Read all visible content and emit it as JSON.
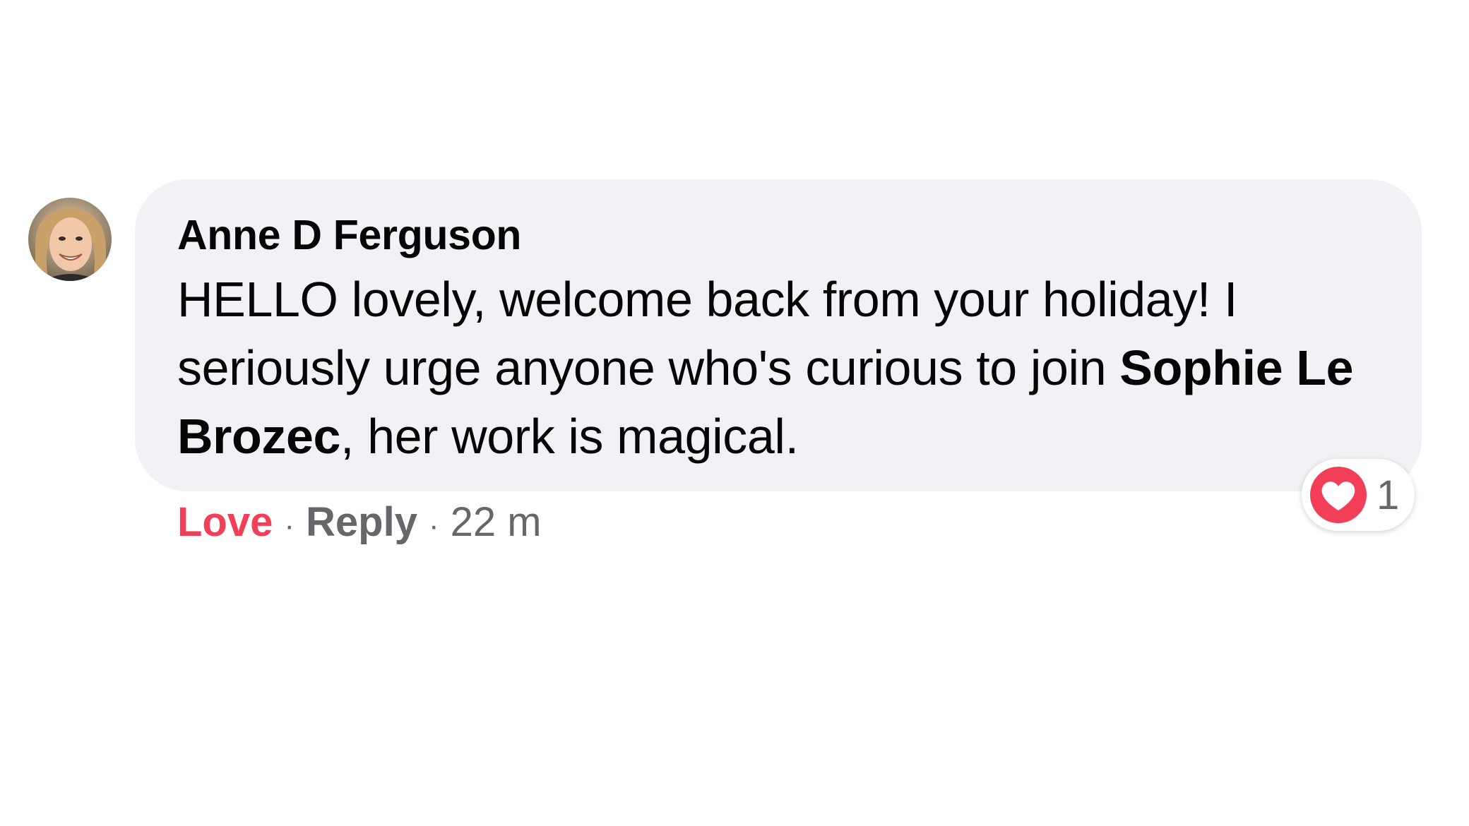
{
  "comment": {
    "author": "Anne D Ferguson",
    "text_part1": "HELLO lovely, welcome back from your holiday! I seriously urge anyone who's curious to join ",
    "mention": "Sophie Le Brozec",
    "text_part2": ", her work is magical."
  },
  "actions": {
    "love_label": "Love",
    "separator": "·",
    "reply_label": "Reply",
    "timestamp": "22 m"
  },
  "reactions": {
    "icon": "heart-icon",
    "count": "1"
  },
  "colors": {
    "bubble_bg": "#f0f2f5",
    "love": "#f33e58",
    "meta": "#65676b",
    "heart": "#f33e58"
  }
}
